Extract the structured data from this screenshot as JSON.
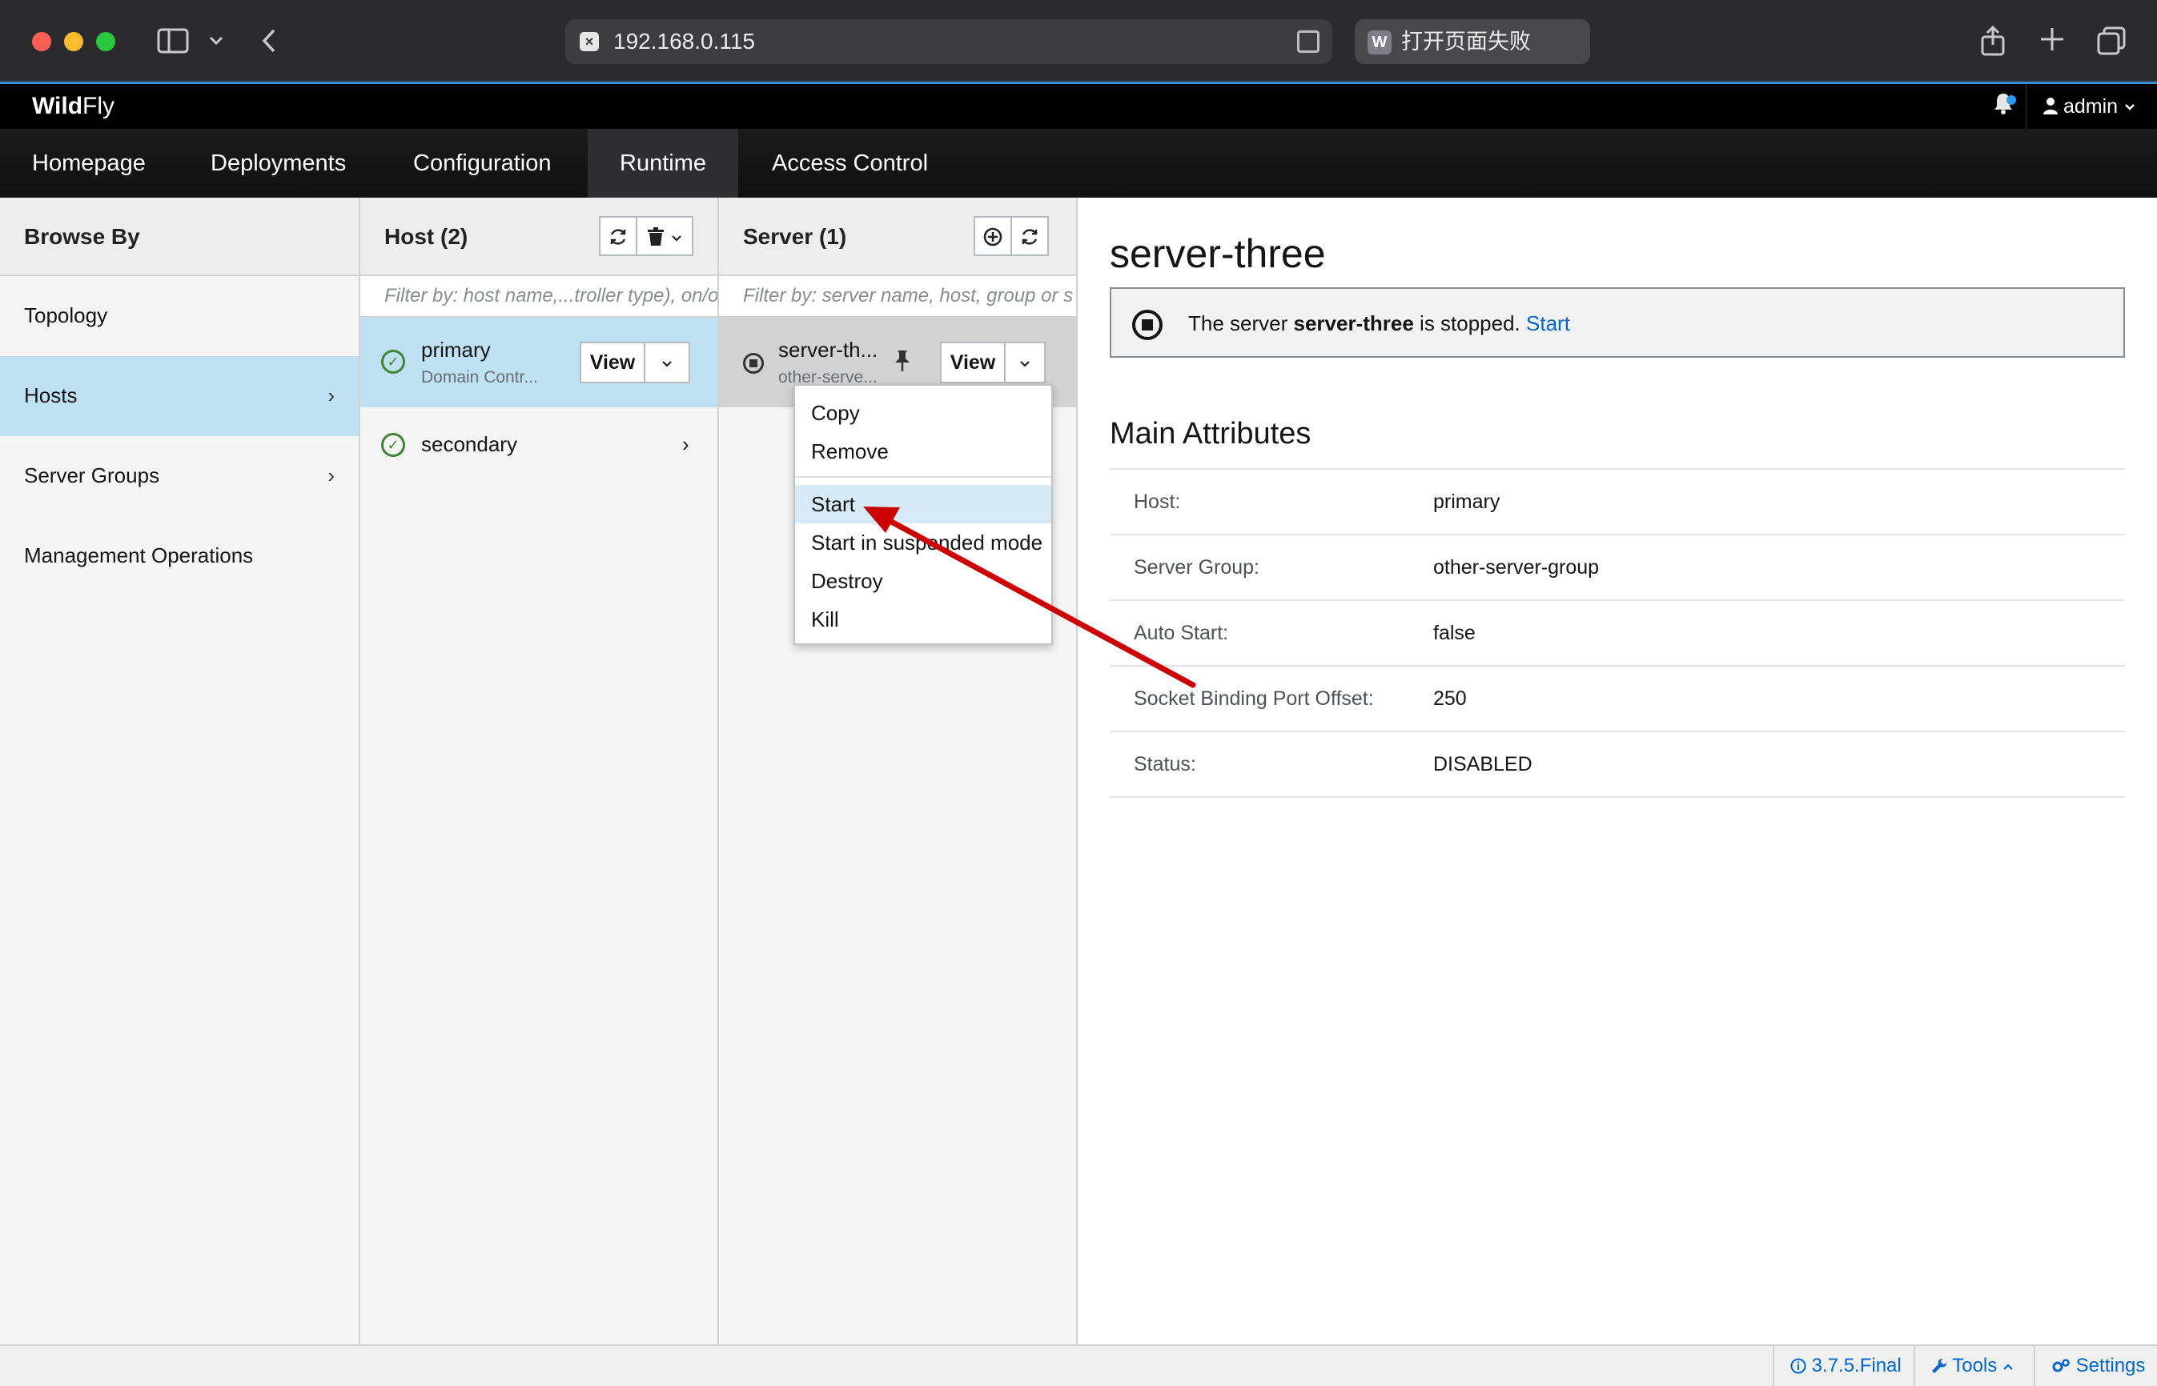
{
  "browser": {
    "url": "192.168.0.115",
    "tab_letter": "W",
    "tab_title": "打开页面失败"
  },
  "header": {
    "logo_bold": "Wild",
    "logo_rest": "Fly",
    "user": "admin"
  },
  "nav": {
    "items": [
      "Homepage",
      "Deployments",
      "Configuration",
      "Runtime",
      "Access Control"
    ],
    "active": "Runtime"
  },
  "browse": {
    "title": "Browse By",
    "items": [
      {
        "label": "Topology",
        "chevron": ""
      },
      {
        "label": "Hosts",
        "chevron": "›"
      },
      {
        "label": "Server Groups",
        "chevron": "›"
      },
      {
        "label": "Management Operations",
        "chevron": ""
      }
    ]
  },
  "hosts": {
    "title": "Host (2)",
    "filter_placeholder": "Filter by: host name,...troller type), on/o",
    "items": [
      {
        "name": "primary",
        "subtitle": "Domain Contr...",
        "view_label": "View"
      },
      {
        "name": "secondary",
        "subtitle": ""
      }
    ]
  },
  "servers": {
    "title": "Server (1)",
    "filter_placeholder": "Filter by: server name, host, group or s",
    "items": [
      {
        "name": "server-th...",
        "subtitle": "other-serve...",
        "view_label": "View"
      }
    ]
  },
  "menu": {
    "items": [
      "Copy",
      "Remove",
      "Start",
      "Start in suspended mode",
      "Destroy",
      "Kill"
    ],
    "highlighted": "Start"
  },
  "detail": {
    "title": "server-three",
    "alert_prefix": "The server ",
    "alert_server": "server-three",
    "alert_middle": " is stopped. ",
    "alert_action": "Start",
    "section_title": "Main Attributes",
    "attributes": [
      {
        "key": "Host:",
        "value": "primary",
        "link": true
      },
      {
        "key": "Server Group:",
        "value": "other-server-group",
        "link": true
      },
      {
        "key": "Auto Start:",
        "value": "false",
        "link": false
      },
      {
        "key": "Socket Binding Port Offset:",
        "value": "250",
        "link": false
      },
      {
        "key": "Status:",
        "value": "DISABLED",
        "link": false
      }
    ]
  },
  "footer": {
    "version": "3.7.5.Final",
    "tools": "Tools",
    "settings": "Settings"
  },
  "colors": {
    "accent": "#0066cc",
    "selected_row": "#bee1f4",
    "ok_green": "#3e8635",
    "annotation_arrow": "#cc0000"
  }
}
